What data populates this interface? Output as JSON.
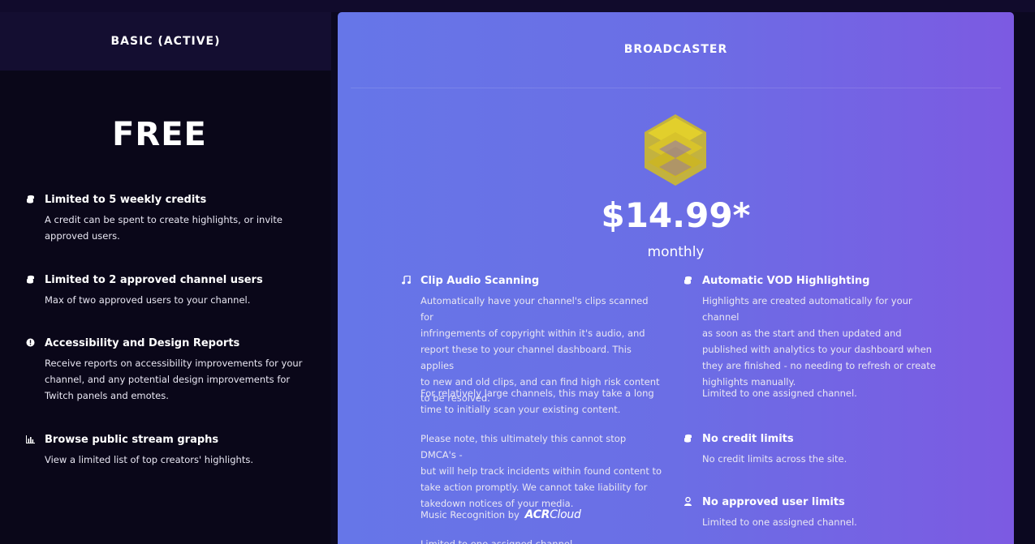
{
  "basic": {
    "header": "BASIC (ACTIVE)",
    "price": "FREE",
    "features": [
      {
        "icon": "coins-icon",
        "title": "Limited to 5 weekly credits",
        "desc_lines": [
          "A credit can be spent to create highlights, or invite",
          "approved users."
        ]
      },
      {
        "icon": "coins-icon",
        "title": "Limited to 2 approved channel users",
        "desc_lines": [
          "Max of two approved users to your channel."
        ]
      },
      {
        "icon": "info-icon",
        "title": "Accessibility and Design Reports",
        "desc_lines": [
          "Receive reports on accessibility improvements for your",
          "channel, and any potential design improvements for",
          "Twitch panels and emotes."
        ]
      },
      {
        "icon": "chart-icon",
        "title": "Browse public stream graphs",
        "desc_lines": [
          "View a limited list of top creators' highlights."
        ]
      }
    ]
  },
  "broadcaster": {
    "header": "BROADCASTER",
    "tier_icon": "stacked-layers-icon",
    "price": "$14.99*",
    "period": "monthly",
    "clip_audio": {
      "icon": "music-note-icon",
      "title": "Clip Audio Scanning",
      "desc_lines": [
        "Automatically have your channel's clips scanned for",
        "infringements of copyright within it's audio, and",
        "report these to your channel dashboard. This applies",
        "to new and old clips, and can find high risk content",
        "to be resolved."
      ],
      "para2_lines": [
        "For relatively large channels, this may take a long",
        "time to initially scan your existing content."
      ],
      "para3_lines": [
        "Please note, this ultimately this cannot stop DMCA's -",
        "but will help track incidents within found content to",
        "take action promptly. We cannot take liability for",
        "takedown notices of your media."
      ],
      "recognition_label": "Music Recognition by",
      "acr_bold": "ACR",
      "acr_light": "Cloud",
      "cut_line": "Limited to one assigned channel."
    },
    "vod": {
      "icon": "coins-icon",
      "title": "Automatic VOD Highlighting",
      "desc_lines": [
        "Highlights are created automatically for your channel",
        "as soon as the start and then updated and",
        "published with analytics to your dashboard when",
        "they are finished - no needing to refresh or create",
        "highlights manually."
      ],
      "note": "Limited to one assigned channel."
    },
    "credit": {
      "icon": "coins-icon",
      "title": "No credit limits",
      "desc": "No credit limits across the site."
    },
    "users": {
      "icon": "user-badge-icon",
      "title": "No approved user limits",
      "desc": "Limited to one assigned channel."
    }
  },
  "colors": {
    "background": "#0a0719",
    "card_start": "#6676e8",
    "card_end": "#7c5ae2",
    "tier_icon": "#d2be1e"
  }
}
